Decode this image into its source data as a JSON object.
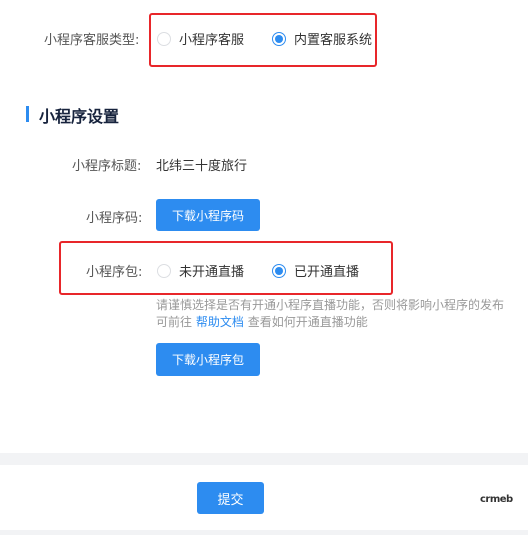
{
  "service_type": {
    "label": "小程序客服类型:",
    "options": [
      {
        "label": "小程序客服",
        "checked": false
      },
      {
        "label": "内置客服系统",
        "checked": true
      }
    ]
  },
  "section": {
    "title": "小程序设置"
  },
  "mini_title": {
    "label": "小程序标题:",
    "value": "北纬三十度旅行"
  },
  "mini_code": {
    "label": "小程序码:",
    "button": "下载小程序码"
  },
  "mini_package": {
    "label": "小程序包:",
    "options": [
      {
        "label": "未开通直播",
        "checked": false
      },
      {
        "label": "已开通直播",
        "checked": true
      }
    ],
    "hint_line1": "请谨慎选择是否有开通小程序直播功能，否则将影响小程序的发布",
    "hint_prefix": "可前往",
    "hint_link": "帮助文档",
    "hint_suffix": "查看如何开通直播功能",
    "button": "下载小程序包"
  },
  "footer": {
    "submit": "提交"
  },
  "logo": {
    "text": "crmeb"
  },
  "colors": {
    "primary": "#2d8cf0",
    "highlight": "#e8262a"
  }
}
